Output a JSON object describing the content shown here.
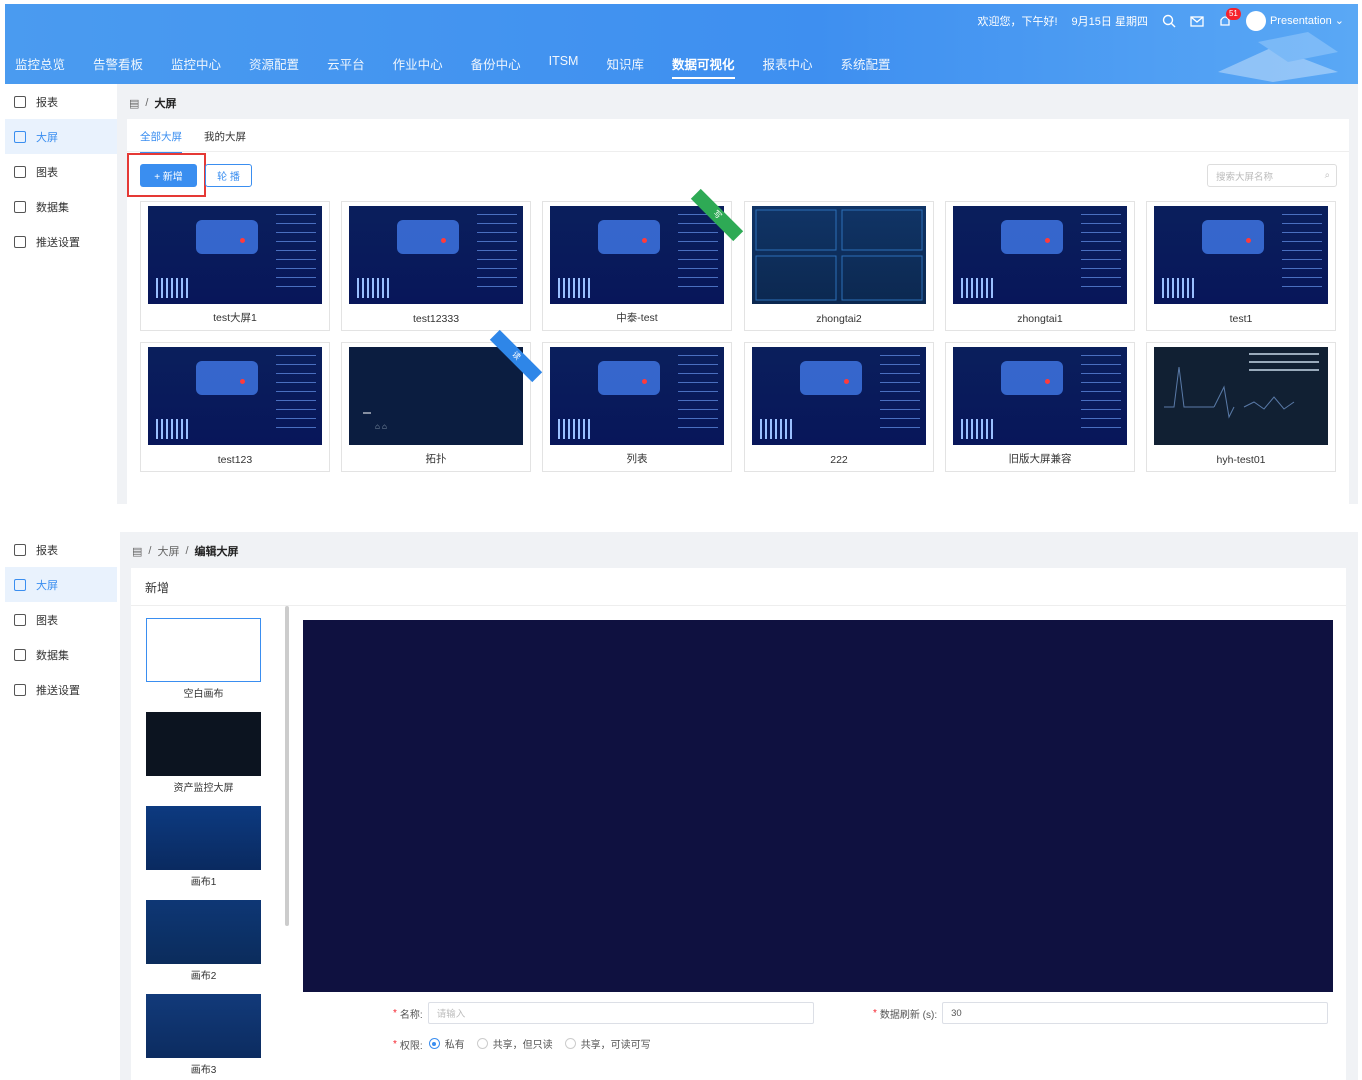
{
  "header": {
    "greeting": "欢迎您，下午好!",
    "date": "9月15日 星期四",
    "notif_count": "51",
    "user": "Presentation"
  },
  "nav": [
    "监控总览",
    "告警看板",
    "监控中心",
    "资源配置",
    "云平台",
    "作业中心",
    "备份中心",
    "ITSM",
    "知识库",
    "数据可视化",
    "报表中心",
    "系统配置"
  ],
  "nav_active": "数据可视化",
  "sidebar": [
    "报表",
    "大屏",
    "图表",
    "数据集",
    "推送设置"
  ],
  "sidebar_active": "大屏",
  "list_page": {
    "breadcrumb": [
      "大屏"
    ],
    "tabs": [
      "全部大屏",
      "我的大屏"
    ],
    "add_button": "+ 新增",
    "rotate_button": "轮 播",
    "search_placeholder": "搜索大屏名称",
    "cards": [
      {
        "label": "test大屏1",
        "style": "dash"
      },
      {
        "label": "test12333",
        "style": "dash"
      },
      {
        "label": "中泰-test",
        "style": "dash",
        "ribbon": "写",
        "ribbon_color": "#2eaa55"
      },
      {
        "label": "zhongtai2",
        "style": "grid"
      },
      {
        "label": "zhongtai1",
        "style": "dash"
      },
      {
        "label": "test1",
        "style": "dash"
      },
      {
        "label": "test123",
        "style": "dash"
      },
      {
        "label": "拓扑",
        "style": "plain",
        "ribbon": "读",
        "ribbon_color": "#2e86e8"
      },
      {
        "label": "列表",
        "style": "dash"
      },
      {
        "label": "222",
        "style": "dash"
      },
      {
        "label": "旧版大屏兼容",
        "style": "dash"
      },
      {
        "label": "hyh-test01",
        "style": "white"
      }
    ]
  },
  "edit_page": {
    "breadcrumb": [
      "大屏",
      "编辑大屏"
    ],
    "title": "新增",
    "templates": [
      "空白画布",
      "资产监控大屏",
      "画布1",
      "画布2",
      "画布3"
    ],
    "form": {
      "name_label": "名称:",
      "name_placeholder": "请输入",
      "refresh_label": "数据刷新 (s):",
      "refresh_value": "30",
      "perm_label": "权限:",
      "perm_options": [
        "私有",
        "共享，但只读",
        "共享，可读可写"
      ],
      "perm_selected": "私有"
    }
  }
}
